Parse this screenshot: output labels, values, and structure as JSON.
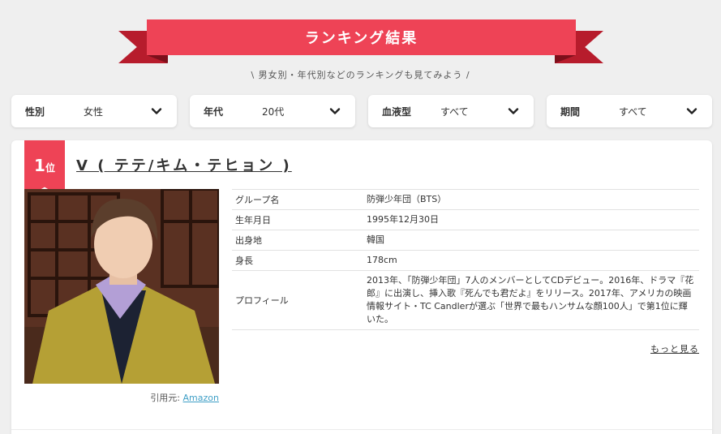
{
  "header": {
    "title": "ランキング結果",
    "subtitle": "\\ 男女別・年代別などのランキングも見てみよう /",
    "accent_color": "#ee4356",
    "accent_dark": "#b71c2c"
  },
  "filters": [
    {
      "label": "性別",
      "value": "女性",
      "icon": "chevron-down-icon"
    },
    {
      "label": "年代",
      "value": "20代",
      "icon": "chevron-down-icon"
    },
    {
      "label": "血液型",
      "value": "すべて",
      "icon": "chevron-down-icon"
    },
    {
      "label": "期間",
      "value": "すべて",
      "icon": "chevron-down-icon"
    }
  ],
  "ranking": {
    "rank_number": "1",
    "rank_suffix": "位",
    "name": "V ( テテ/キム・テヒョン )",
    "details": [
      {
        "key": "グループ名",
        "value": "防弾少年団（BTS）"
      },
      {
        "key": "生年月日",
        "value": "1995年12月30日"
      },
      {
        "key": "出身地",
        "value": "韓国"
      },
      {
        "key": "身長",
        "value": "178cm"
      },
      {
        "key": "プロフィール",
        "value": "2013年、「防弾少年団」7人のメンバーとしてCDデビュー。2016年、ドラマ『花郎』に出演し、挿入歌『死んでも君だよ』をリリース。2017年、アメリカの映画情報サイト・TC Candlerが選ぶ「世界で最もハンサムな顔100人」で第1位に輝いた。"
      }
    ],
    "more_label": "もっと見る",
    "credit_prefix": "引用元:",
    "credit_link": "Amazon"
  }
}
